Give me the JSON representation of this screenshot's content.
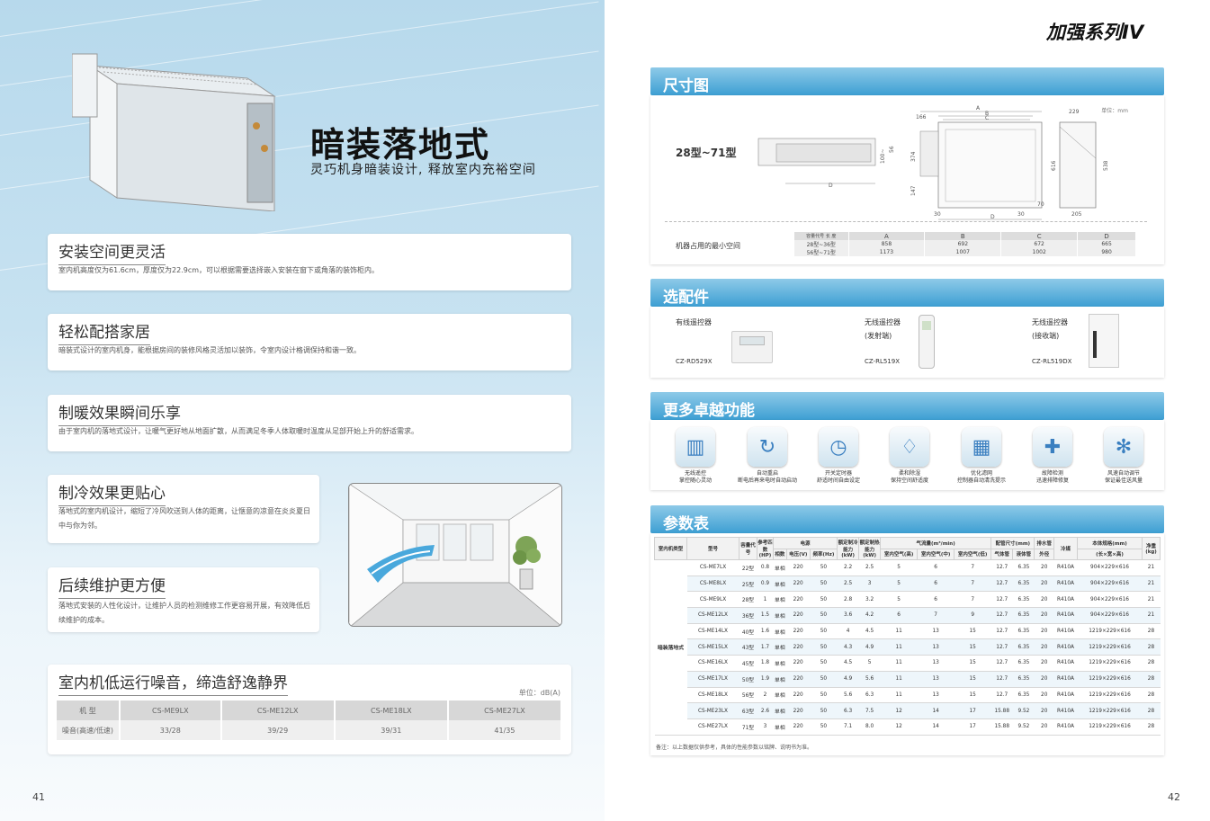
{
  "left_page": {
    "hero_title": "暗装落地式",
    "hero_subtitle": "灵巧机身暗装设计, 释放室内充裕空间",
    "features": [
      {
        "title": "安装空间更灵活",
        "text": "室内机高度仅为61.6cm，厚度仅为22.9cm，可以根据需要选择嵌入安装在窗下或角落的装饰柜内。"
      },
      {
        "title": "轻松配搭家居",
        "text": "暗装式设计的室内机身，能根据房间的装修风格灵活加以装饰，令室内设计格调保持和谐一致。"
      },
      {
        "title": "制暖效果瞬间乐享",
        "text": "由于室内机的落地式设计，让暖气更好地从地面扩散，从而满足冬季人体取暖时温度从足部开始上升的舒适需求。"
      },
      {
        "title": "制冷效果更贴心",
        "text": "落地式的室内机设计，缩短了冷风吹送到人体的距离，让惬意的凉意在炎炎夏日中与你为邻。"
      },
      {
        "title": "后续维护更方便",
        "text": "落地式安装的人性化设计，让维护人员的检测维修工作更容易开展，有效降低后续维护的成本。"
      }
    ],
    "noise": {
      "title": "室内机低运行噪音，缔造舒逸静界",
      "unit": "单位：dB(A)",
      "header_label": "机 型",
      "models": [
        "CS-ME9LX",
        "CS-ME12LX",
        "CS-ME18LX",
        "CS-ME27LX"
      ],
      "row_label": "噪音(高速/低速)",
      "values": [
        "33/28",
        "39/29",
        "39/31",
        "41/35"
      ]
    },
    "page_number": "41"
  },
  "right_page": {
    "series_title": "加强系列IV",
    "page_number": "42",
    "dimensions": {
      "section_title": "尺寸图",
      "model_range": "28型~71型",
      "unit": "单位：mm",
      "labels": {
        "a": "A",
        "b": "B",
        "c": "C",
        "d": "D",
        "d2": "D",
        "d166": "166",
        "d229": "229",
        "d374": "374",
        "d147": "147",
        "d616": "616",
        "d538": "538",
        "d30a": "30",
        "d30b": "30",
        "d70": "70",
        "d205": "205",
        "d100": "100~",
        "d56": "56"
      },
      "min_space_label": "机器占用的最小空间",
      "table_header_model": "容量代号",
      "table_header_length": "长 度",
      "columns": [
        "A",
        "B",
        "C",
        "D"
      ],
      "rows": [
        {
          "model": "28型~36型",
          "values": [
            "858",
            "692",
            "672",
            "665"
          ]
        },
        {
          "model": "56型~71型",
          "values": [
            "1173",
            "1007",
            "1002",
            "980"
          ]
        }
      ]
    },
    "accessories": {
      "section_title": "选配件",
      "items": [
        {
          "name": "有线遥控器",
          "sub": "",
          "code": "CZ-RD529X"
        },
        {
          "name": "无线遥控器",
          "sub": "(发射端)",
          "code": "CZ-RL519X"
        },
        {
          "name": "无线遥控器",
          "sub": "(接收端)",
          "code": "CZ-RL519DX"
        }
      ]
    },
    "functions": {
      "section_title": "更多卓越功能",
      "items": [
        {
          "line1": "无线遥控",
          "line2": "掌控随心灵动",
          "icon": "remote-icon"
        },
        {
          "line1": "自动重启",
          "line2": "断电后再来电时自动启动",
          "icon": "restart-icon"
        },
        {
          "line1": "开关定时器",
          "line2": "舒适时间自由设定",
          "icon": "timer-icon"
        },
        {
          "line1": "柔和除湿",
          "line2": "保持空间舒适度",
          "icon": "dehumidify-icon"
        },
        {
          "line1": "优化滤网",
          "line2": "控制器自动清洗提示",
          "icon": "filter-icon"
        },
        {
          "line1": "故障检测",
          "line2": "迅速排障修复",
          "icon": "diagnosis-icon"
        },
        {
          "line1": "风速自动调节",
          "line2": "保证最佳送风量",
          "icon": "fan-icon"
        }
      ]
    },
    "params": {
      "section_title": "参数表",
      "headers": {
        "type": "室内机类型",
        "model": "型号",
        "capacity_code": "容量代号",
        "reference_hp": "参考匹数(HP)",
        "power": "电源",
        "phase": "相数",
        "voltage": "电压(V)",
        "frequency": "频率(Hz)",
        "cooling": "额定制冷能力(kW)",
        "heating": "额定制热能力(kW)",
        "airflow": "气流量(m³/min)",
        "air_high": "室内空气(高)",
        "air_mid": "室内空气(中)",
        "air_low": "室内空气(低)",
        "pipe": "配管尺寸(mm)",
        "gas": "气体管",
        "liquid": "液体管",
        "drain": "排水管",
        "drain_od": "外径",
        "refrigerant": "冷媒",
        "size": "本体规格(mm)",
        "size_sub": "(长×宽×高)",
        "weight": "净重(kg)"
      },
      "type_label": "暗装落地式",
      "rows": [
        [
          "CS-ME7LX",
          "22型",
          "0.8",
          "单相",
          "220",
          "50",
          "2.2",
          "2.5",
          "5",
          "6",
          "7",
          "12.7",
          "6.35",
          "20",
          "R410A",
          "904×229×616",
          "21"
        ],
        [
          "CS-ME8LX",
          "25型",
          "0.9",
          "单相",
          "220",
          "50",
          "2.5",
          "3",
          "5",
          "6",
          "7",
          "12.7",
          "6.35",
          "20",
          "R410A",
          "904×229×616",
          "21"
        ],
        [
          "CS-ME9LX",
          "28型",
          "1",
          "单相",
          "220",
          "50",
          "2.8",
          "3.2",
          "5",
          "6",
          "7",
          "12.7",
          "6.35",
          "20",
          "R410A",
          "904×229×616",
          "21"
        ],
        [
          "CS-ME12LX",
          "36型",
          "1.5",
          "单相",
          "220",
          "50",
          "3.6",
          "4.2",
          "6",
          "7",
          "9",
          "12.7",
          "6.35",
          "20",
          "R410A",
          "904×229×616",
          "21"
        ],
        [
          "CS-ME14LX",
          "40型",
          "1.6",
          "单相",
          "220",
          "50",
          "4",
          "4.5",
          "11",
          "13",
          "15",
          "12.7",
          "6.35",
          "20",
          "R410A",
          "1219×229×616",
          "28"
        ],
        [
          "CS-ME15LX",
          "43型",
          "1.7",
          "单相",
          "220",
          "50",
          "4.3",
          "4.9",
          "11",
          "13",
          "15",
          "12.7",
          "6.35",
          "20",
          "R410A",
          "1219×229×616",
          "28"
        ],
        [
          "CS-ME16LX",
          "45型",
          "1.8",
          "单相",
          "220",
          "50",
          "4.5",
          "5",
          "11",
          "13",
          "15",
          "12.7",
          "6.35",
          "20",
          "R410A",
          "1219×229×616",
          "28"
        ],
        [
          "CS-ME17LX",
          "50型",
          "1.9",
          "单相",
          "220",
          "50",
          "4.9",
          "5.6",
          "11",
          "13",
          "15",
          "12.7",
          "6.35",
          "20",
          "R410A",
          "1219×229×616",
          "28"
        ],
        [
          "CS-ME18LX",
          "56型",
          "2",
          "单相",
          "220",
          "50",
          "5.6",
          "6.3",
          "11",
          "13",
          "15",
          "12.7",
          "6.35",
          "20",
          "R410A",
          "1219×229×616",
          "28"
        ],
        [
          "CS-ME23LX",
          "63型",
          "2.6",
          "单相",
          "220",
          "50",
          "6.3",
          "7.5",
          "12",
          "14",
          "17",
          "15.88",
          "9.52",
          "20",
          "R410A",
          "1219×229×616",
          "28"
        ],
        [
          "CS-ME27LX",
          "71型",
          "3",
          "单相",
          "220",
          "50",
          "7.1",
          "8.0",
          "12",
          "14",
          "17",
          "15.88",
          "9.52",
          "20",
          "R410A",
          "1219×229×616",
          "28"
        ]
      ],
      "note": "备注：以上数据仅供参考，具体的性能参数以铭牌、说明书为准。"
    }
  },
  "colors": {
    "accent": "#3d9fd3",
    "accent_light": "#8ecae8",
    "left_bg": "#c7e2f1"
  }
}
